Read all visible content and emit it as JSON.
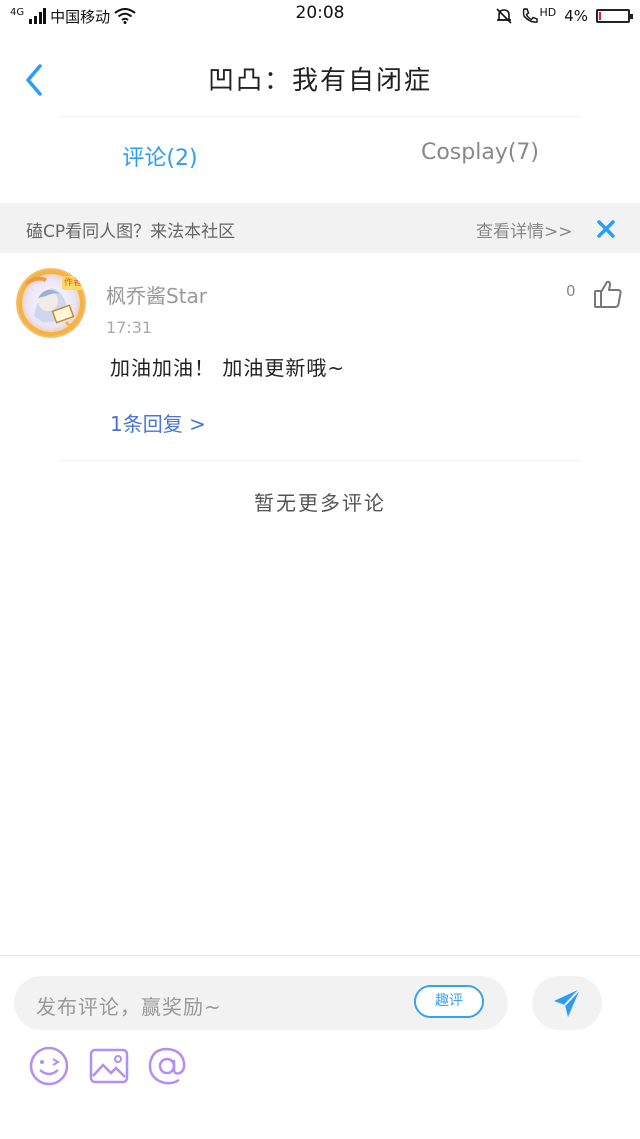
{
  "status_bar": {
    "network": "4G",
    "carrier": "中国移动",
    "time": "20:08",
    "hd": "HD",
    "battery": "4%",
    "battery_level": 0.04,
    "battery_color": "#e02020"
  },
  "header": {
    "back_icon": "chevron-left-icon",
    "title": "凹凸：我有自闭症"
  },
  "tabs": [
    {
      "label": "评论(2)",
      "active": true
    },
    {
      "label": "Cosplay(7)",
      "active": false
    }
  ],
  "banner": {
    "text": "磕CP看同人图？来法本社区",
    "link": "查看详情>>",
    "close_icon": "close-icon"
  },
  "comments": [
    {
      "username": "枫乔酱Star",
      "author_badge": "作者",
      "time": "17:31",
      "likes": "0",
      "text": "加油加油！ 加油更新哦~",
      "replies": "1条回复 >"
    }
  ],
  "no_more": "暂无更多评论",
  "composer": {
    "placeholder": "发布评论，赢奖励~",
    "fun_label": "趣评",
    "send_icon": "send-icon",
    "tools": [
      "emoji-icon",
      "image-icon",
      "at-icon"
    ]
  },
  "colors": {
    "accent": "#2a9df4",
    "link": "#4a74d8",
    "tool_purple": "#b48ef0"
  }
}
